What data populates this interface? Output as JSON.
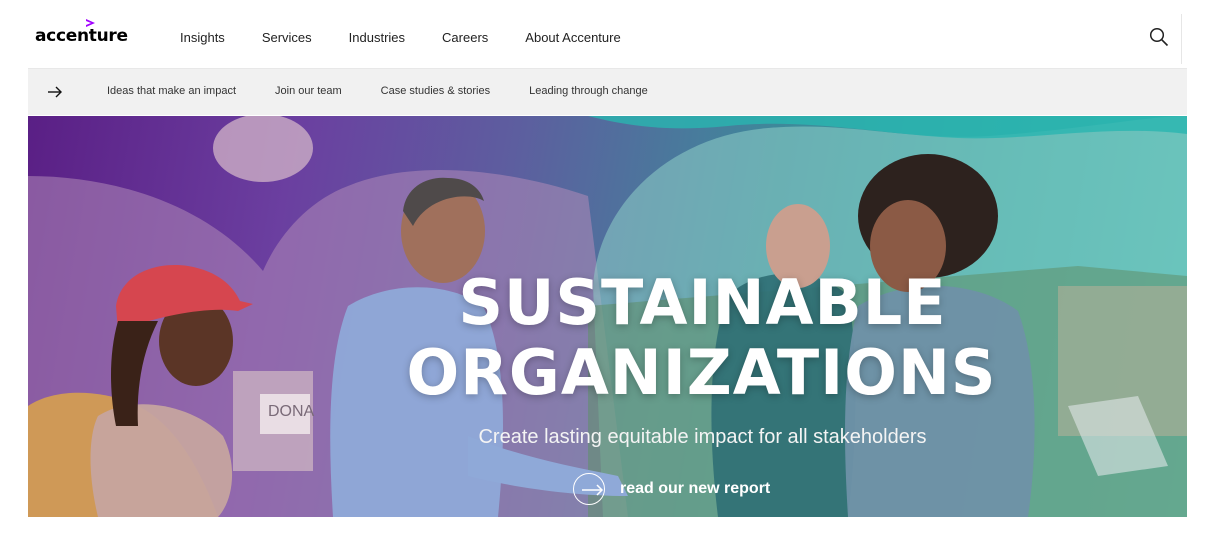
{
  "brand": {
    "logo_text": "accenture",
    "accent_color": "#a100ff"
  },
  "topnav": {
    "items": [
      "Insights",
      "Services",
      "Industries",
      "Careers",
      "About Accenture"
    ],
    "search_icon": "search-icon"
  },
  "subnav": {
    "arrow_icon": "arrow-right-icon",
    "items": [
      "Ideas that make an impact",
      "Join our team",
      "Case studies & stories",
      "Leading through change"
    ]
  },
  "hero": {
    "headline_line1": "SUSTAINABLE",
    "headline_line2": "ORGANIZATIONS",
    "subheadline": "Create lasting equitable impact for all stakeholders",
    "cta_label": "read our new report",
    "cta_icon": "arrow-circle-icon",
    "sign_text": "DONA",
    "colors": {
      "purple": "#5a1f85",
      "teal": "#3fb9b0"
    }
  }
}
